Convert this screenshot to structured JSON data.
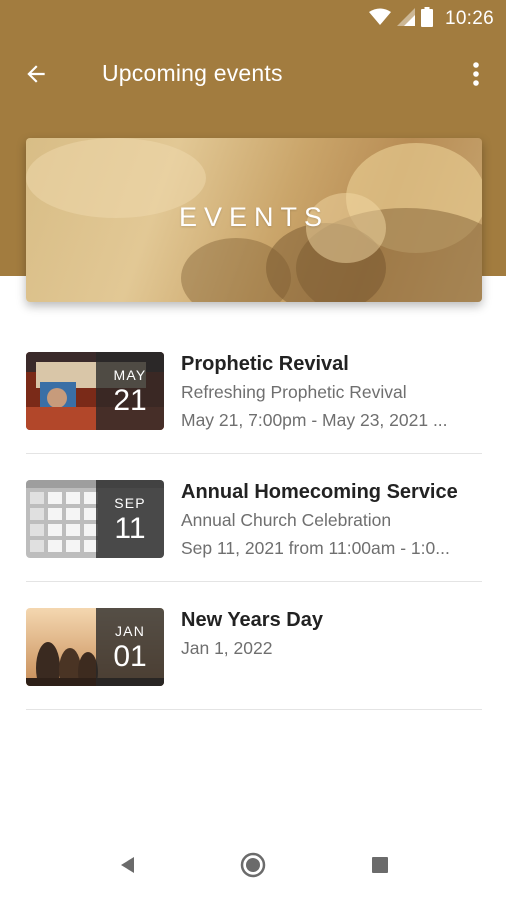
{
  "status_bar": {
    "time": "10:26",
    "icons": [
      "wifi-icon",
      "signal-icon",
      "battery-icon"
    ]
  },
  "app_bar": {
    "title": "Upcoming events",
    "back_icon": "arrow-back-icon",
    "menu_icon": "more-vert-icon"
  },
  "hero": {
    "title": "EVENTS"
  },
  "events": [
    {
      "title": "Prophetic Revival",
      "subtitle": "Refreshing Prophetic Revival",
      "dates": "May 21, 7:00pm - May 23, 2021 ...",
      "month": "MAY",
      "day": "21"
    },
    {
      "title": "Annual Homecoming Service",
      "subtitle": "Annual Church Celebration",
      "dates": "Sep 11, 2021 from 11:00am - 1:0...",
      "month": "SEP",
      "day": "11"
    },
    {
      "title": "New Years Day",
      "subtitle": "",
      "dates": "Jan 1, 2022",
      "month": "JAN",
      "day": "01"
    }
  ],
  "nav_bar": {
    "icons": [
      "back-triangle-icon",
      "home-circle-icon",
      "recents-square-icon"
    ]
  },
  "colors": {
    "primary": "#a27c3f",
    "title_text": "#222222",
    "secondary_text": "#6f6f6f",
    "divider": "#e4e4e4"
  }
}
